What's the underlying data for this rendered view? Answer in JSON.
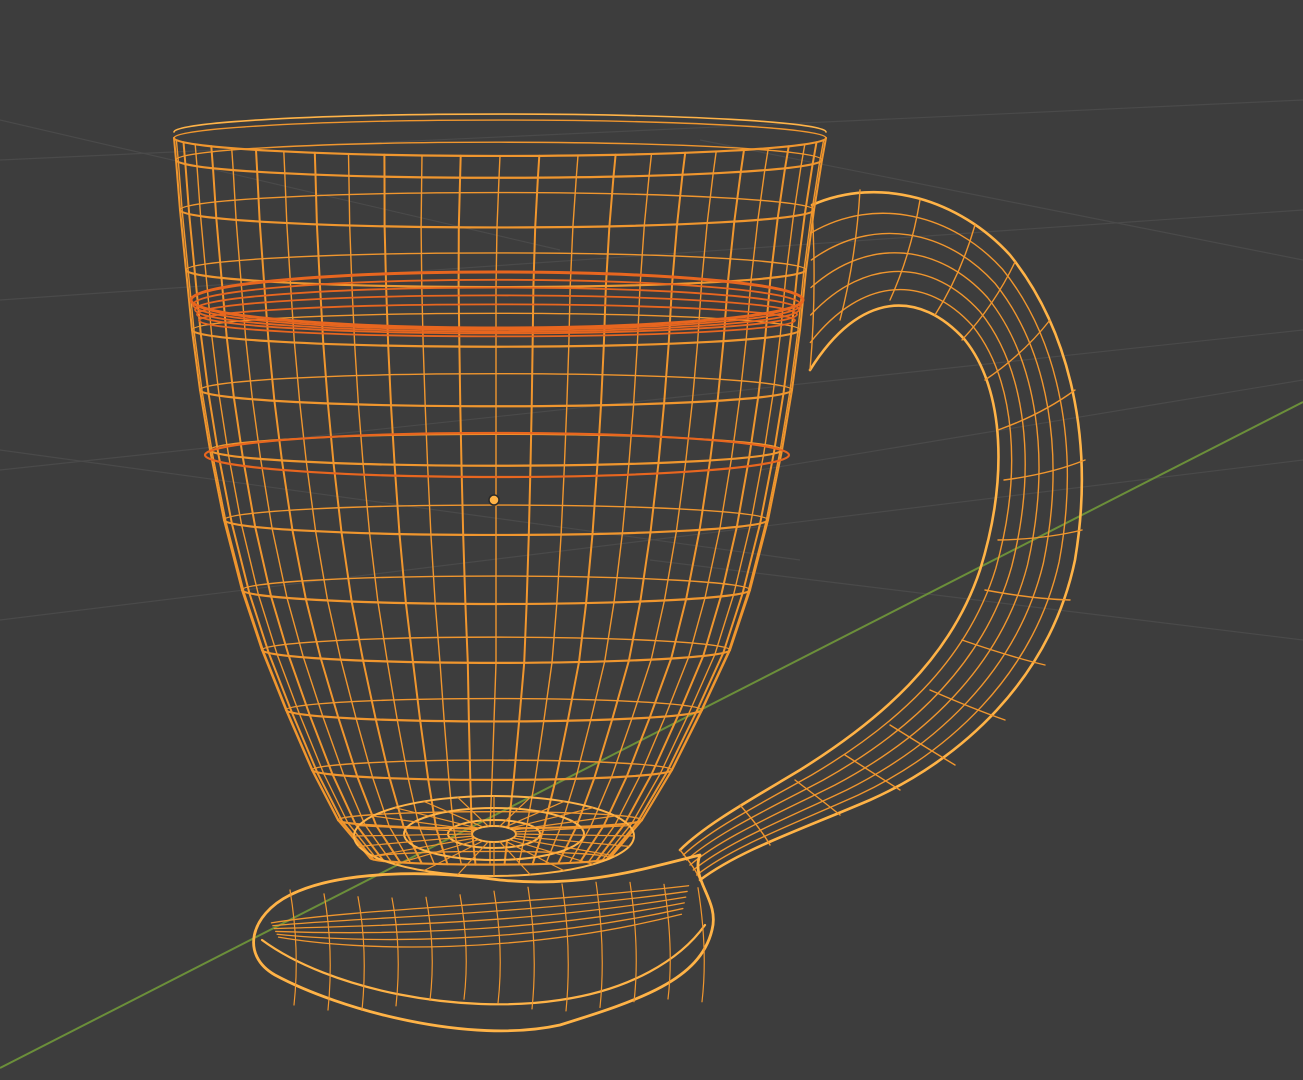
{
  "viewport": {
    "shading_mode": "wireframe",
    "background_color": "#3d3d3d",
    "grid_color": "#4a4a4a",
    "x_axis_color": "#6b8f3a"
  },
  "object": {
    "name": "mug",
    "parts": [
      "cup-body",
      "liquid-surface",
      "handle",
      "spoon-foot"
    ],
    "selected": true,
    "wire_color": "#f0962e",
    "wire_highlight_color": "#ffb347",
    "liquid_color": "#e8661f",
    "origin_color": "#ffb347"
  }
}
